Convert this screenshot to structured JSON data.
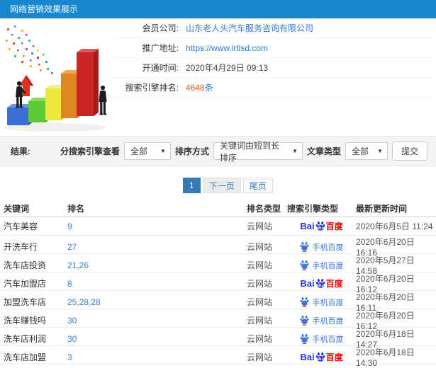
{
  "title_bar": {
    "title": "网络营销效果展示"
  },
  "info": {
    "rows": [
      {
        "label": "会员公司:",
        "value": "山东老人头汽车服务咨询有限公司",
        "type": "link"
      },
      {
        "label": "推广地址:",
        "value": "https://www.lrtlsd.com",
        "type": "link"
      },
      {
        "label": "开通时间:",
        "value": "2020年4月29日 09:13",
        "type": "text"
      },
      {
        "label": "搜索引擎排名:",
        "value_count": "4648",
        "value_unit": "条",
        "type": "count"
      }
    ]
  },
  "filters": {
    "result_label": "结果:",
    "engine_filter_label": "分搜索引擎查看",
    "engine_filter_value": "全部",
    "sort_label": "排序方式",
    "sort_value": "关键词由短到长排序",
    "article_type_label": "文章类型",
    "article_type_value": "全部",
    "submit_label": "提交"
  },
  "pagination": {
    "current": "1",
    "next": "下一页",
    "last": "尾页"
  },
  "table": {
    "headers": [
      "关键词",
      "排名",
      "排名类型",
      "搜索引擎类型",
      "最新更新时间"
    ],
    "rows": [
      {
        "keyword": "汽车美容",
        "rank": "9",
        "rank_type": "云网站",
        "engine": "baidu-pc",
        "engine_label": "Baidu百度",
        "updated": "2020年6月5日 11:24"
      },
      {
        "keyword": "开洗车行",
        "rank": "27",
        "rank_type": "云网站",
        "engine": "baidu-mobile",
        "engine_label": "手机百度",
        "updated": "2020年6月20日 16:16"
      },
      {
        "keyword": "洗车店投资",
        "rank": "21,26",
        "rank_type": "云网站",
        "engine": "baidu-mobile",
        "engine_label": "手机百度",
        "updated": "2020年5月27日 14:58"
      },
      {
        "keyword": "汽车加盟店",
        "rank": "8",
        "rank_type": "云网站",
        "engine": "baidu-pc",
        "engine_label": "Baidu百度",
        "updated": "2020年6月20日 16:12"
      },
      {
        "keyword": "加盟洗车店",
        "rank": "25,28,28",
        "rank_type": "云网站",
        "engine": "baidu-mobile",
        "engine_label": "手机百度",
        "updated": "2020年6月20日 16:11"
      },
      {
        "keyword": "洗车赚钱吗",
        "rank": "30",
        "rank_type": "云网站",
        "engine": "baidu-mobile",
        "engine_label": "手机百度",
        "updated": "2020年6月20日 16:12"
      },
      {
        "keyword": "洗车店利润",
        "rank": "30",
        "rank_type": "云网站",
        "engine": "baidu-mobile",
        "engine_label": "手机百度",
        "updated": "2020年6月18日 14:27"
      },
      {
        "keyword": "洗车店加盟",
        "rank": "3",
        "rank_type": "云网站",
        "engine": "baidu-pc",
        "engine_label": "Baidu百度",
        "updated": "2020年6月18日 14:30"
      }
    ]
  },
  "engine_logos": {
    "baidu_pc": {
      "part1": "Bai",
      "part2": "du",
      "part3": "百度"
    },
    "baidu_mobile": {
      "label": "手机百度"
    }
  },
  "colors": {
    "titlebar": "#1787d0",
    "accent": "#337ab7",
    "link": "#2f7cd2",
    "count_orange": "#ff5a00",
    "baidu_blue": "#2932e1",
    "baidu_red": "#e10601"
  }
}
